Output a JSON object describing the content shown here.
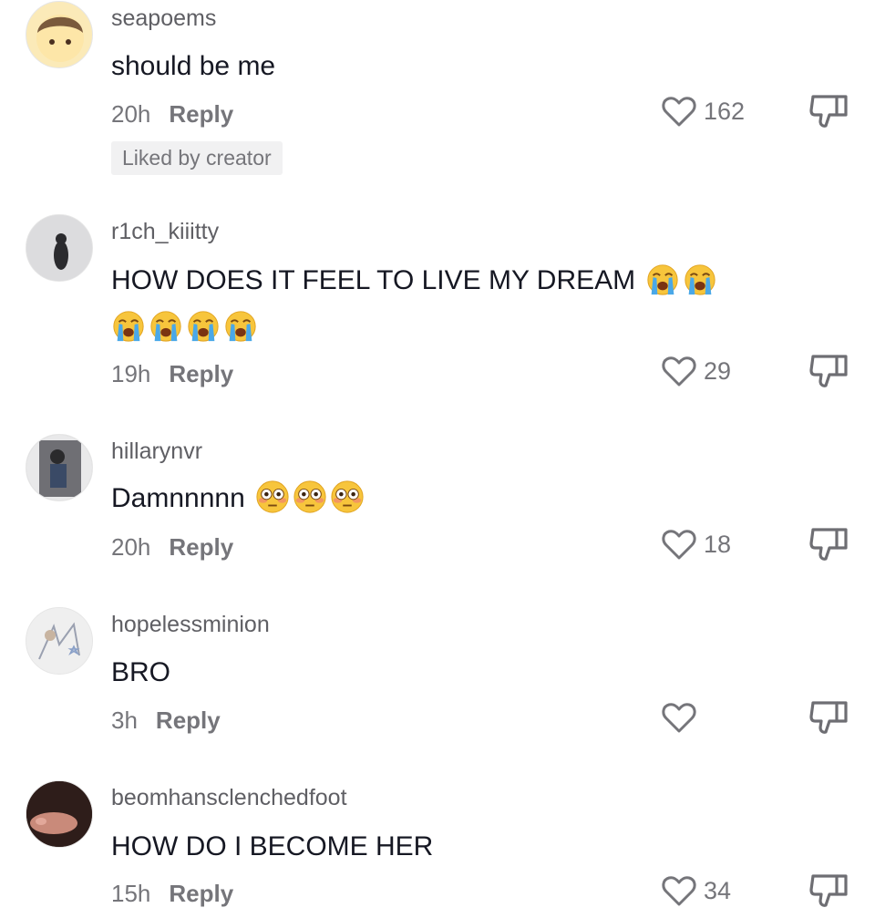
{
  "comments": [
    {
      "username": "seapoems",
      "text": "should be me",
      "time": "20h",
      "reply_label": "Reply",
      "likes": "162",
      "badge": "Liked by creator",
      "emojis": []
    },
    {
      "username": "r1ch_kiiitty",
      "text": "HOW DOES IT FEEL TO LIVE MY DREAM",
      "time": "19h",
      "reply_label": "Reply",
      "likes": "29",
      "emojis": [
        "crying-face-emoji",
        "crying-face-emoji",
        "crying-face-emoji",
        "crying-face-emoji",
        "crying-face-emoji",
        "crying-face-emoji"
      ]
    },
    {
      "username": "hillarynvr",
      "text": "Damnnnnn",
      "time": "20h",
      "reply_label": "Reply",
      "likes": "18",
      "emojis": [
        "flushed-face-emoji",
        "flushed-face-emoji",
        "flushed-face-emoji"
      ]
    },
    {
      "username": "hopelessminion",
      "text": "BRO",
      "time": "3h",
      "reply_label": "Reply",
      "likes": "",
      "emojis": []
    },
    {
      "username": "beomhansclenchedfoot",
      "text": "HOW DO I BECOME HER",
      "time": "15h",
      "reply_label": "Reply",
      "likes": "34",
      "emojis": []
    }
  ],
  "colors": {
    "text": "#161823",
    "secondary": "#75757a",
    "badge_bg": "#f1f1f2"
  },
  "icons": {
    "like": "heart-outline-icon",
    "dislike": "thumbs-down-icon"
  }
}
